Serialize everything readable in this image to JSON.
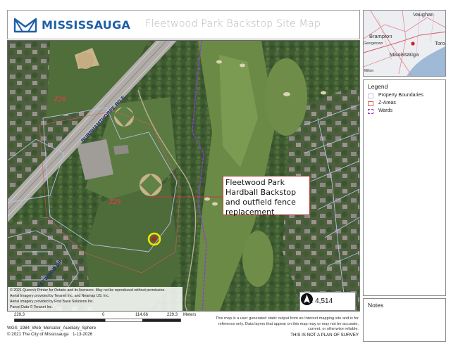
{
  "header": {
    "logo_text": "MISSISSAUGA",
    "title": "Fleetwood Park Backstop Site Map"
  },
  "map": {
    "callout_text": "Fleetwood Park Hardball Backstop and outfield fence replacement",
    "zone_labels": [
      "Z26",
      "Z29"
    ],
    "road_labels": [
      "BURNHAMTHORPE RD E",
      "FLEETWOOD DR"
    ],
    "scale_ratio": "1: 4,514",
    "credits": [
      "© 2021 Queen's Printer for Ontario and its licensors.  May not be reproduced without permission.",
      "Aerial Imagery provided by Teranet Inc. and Neamap US, Inc.",
      "Aerial Imagery provided by First Base Solutions Inc.",
      "Parcel Data © Teranet Inc."
    ],
    "colors": {
      "property_boundary": "#b7c3e6",
      "z_area": "#e05a5a",
      "ward": "#8a3fd0",
      "callout_border": "#c23b3b",
      "target_marker": "#f2e600"
    }
  },
  "footer": {
    "scale_labels": [
      "229.3",
      "0",
      "114.66",
      "229.3"
    ],
    "scale_units": "Meters",
    "projection": "WGS_1984_Web_Mercator_Auxiliary_Sphere",
    "copyright": "© 2021 The City of Mississauga",
    "print_date": "1-13-2026",
    "disclaimer": "This map is a user generated static output from an Internet mapping site and is for reference only. Data layers that appear on this map may or may not be accurate, current, or otherwise reliable.",
    "not_survey": "THIS IS NOT A PLAN OF SURVEY"
  },
  "overview": {
    "labels": [
      "Vaughan",
      "Brampton",
      "Toror",
      "Georgetown",
      "Mississauga",
      "Milton"
    ]
  },
  "legend": {
    "title": "Legend",
    "items": [
      {
        "label": "Property Boundaries",
        "color": "#b7c3e6"
      },
      {
        "label": "Z-Areas",
        "color": "#e05a5a"
      },
      {
        "label": "Wards",
        "color": "#8a3fd0"
      }
    ]
  },
  "notes": {
    "title": "Notes"
  }
}
